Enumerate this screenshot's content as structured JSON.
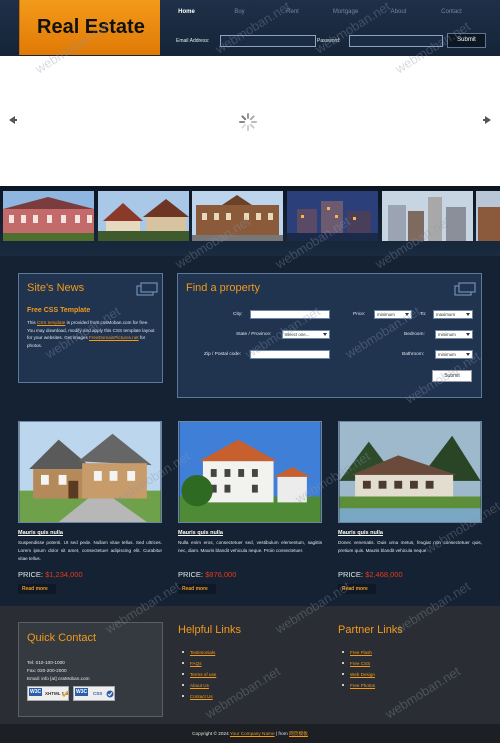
{
  "header": {
    "logo_text": "Real Estate",
    "nav": [
      "Home",
      "Buy",
      "Rent",
      "Mortgage",
      "About",
      "Contact"
    ],
    "email_label": "Email Address:",
    "password_label": "Password:",
    "submit_label": "Submit"
  },
  "slider": {
    "prev_icon": "arrow-left-icon",
    "next_icon": "arrow-right-icon"
  },
  "news": {
    "title": "Site's News",
    "subtitle": "Free CSS Template",
    "text_1": "This ",
    "link_1": "CSS template",
    "text_2": " is provided from cssMoban.com for free. You may download, modify and apply this CSS template layout for your websites. Get images ",
    "link_2": "FreeDomainPictures.net",
    "text_3": " for photos."
  },
  "find": {
    "title": "Find a property",
    "city_label": "City:",
    "state_label": "State / Province:",
    "state_value": "Select one...",
    "zip_label": "Zip / Postal code:",
    "price_label": "Price:",
    "to_label": "To:",
    "bedroom_label": "Bedroom:",
    "bathroom_label": "Bathroom:",
    "minimum": "minimum",
    "maximum": "maximum",
    "submit": "Submit"
  },
  "properties": [
    {
      "title": "Mauris quis nulla",
      "desc": "Suspendisse potenti. Ut sed pede. Nullam vitae tellus. Sed ultrices. Lorem ipsum dolor sit amet, consectetuer adipiscing elit. Curabitur vitae tellus.",
      "price_label": "PRICE:",
      "price": "$1,234,000",
      "more": "Read more"
    },
    {
      "title": "Mauris quis nulla",
      "desc": "Nulla enim eros, consectetuer sed, vestibulum elementum, sagittis nec, diam. Mauris blandit vehicula neque. Proin consectetuer.",
      "price_label": "PRICE:",
      "price": "$876,000",
      "more": "Read more"
    },
    {
      "title": "Mauris quis nulla",
      "desc": "Donec venenatis. Duis urna metus, feugiat non consectetuer quis, pretium quis. Mauris blandit vehicula neque.",
      "price_label": "PRICE:",
      "price": "$2,468,000",
      "more": "Read more"
    }
  ],
  "contact": {
    "title": "Quick Contact",
    "tel": "Tel: 010-100-1000",
    "fax": "Fax: 020-200-2000",
    "email": "Email: info [at] cssMoban.com",
    "badge_1": "XHTML 1.0",
    "badge_2": "CSS"
  },
  "helpful": {
    "title": "Helpful Links",
    "items": [
      "Testimonials",
      "FAQs",
      "Terms of use",
      "About Us",
      "Contact Us"
    ]
  },
  "partner": {
    "title": "Partner Links",
    "items": [
      "Free Flash",
      "Free CSS",
      "Web Design",
      "Free Photos"
    ]
  },
  "footer": {
    "prefix": "Copyright © 2024 ",
    "company": "Your Company Name",
    "middle": " | from ",
    "source": "网页模板"
  },
  "watermark": "webmoban.net",
  "colors": {
    "accent": "#f39a1a",
    "price": "#e23a1d",
    "panel": "#203450",
    "background": "#152233"
  }
}
